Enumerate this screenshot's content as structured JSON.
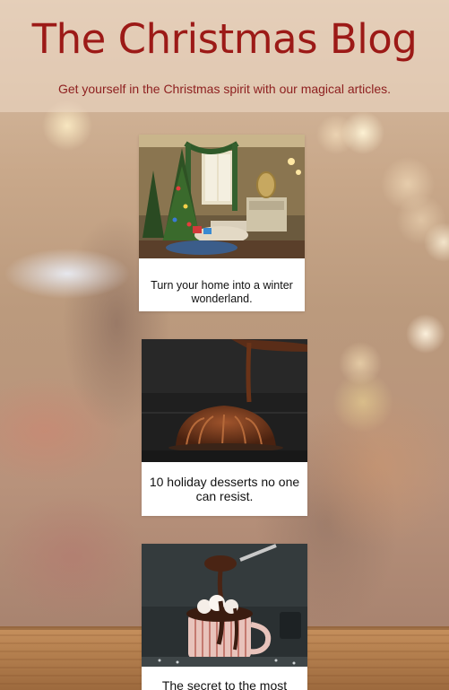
{
  "header": {
    "title": "The Christmas Blog",
    "tagline": "Get yourself in the Christmas spirit with our magical articles."
  },
  "articles": [
    {
      "caption": "Turn your home into a winter wonderland.",
      "image_icon": "decorated-living-room-image"
    },
    {
      "caption": "10 holiday desserts no one can resist.",
      "image_icon": "chocolate-bundt-cake-image"
    },
    {
      "caption": "The secret to the most",
      "image_icon": "hot-chocolate-mug-image"
    }
  ],
  "colors": {
    "title": "#9c1a17",
    "tagline": "#8e2020",
    "card_background": "#ffffff"
  }
}
